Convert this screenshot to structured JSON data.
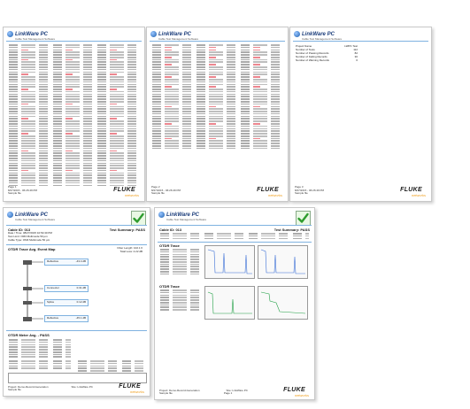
{
  "brand": {
    "product": "LinkWare PC",
    "subtitle": "Cable Test Management Software",
    "fluke": "FLUKE",
    "fluke_sub": "networks"
  },
  "colors": {
    "accent_blue": "#7fb2e0",
    "brand_orange": "#f0a020",
    "fail_red": "#d22233",
    "pass_green": "#2e9c2e"
  },
  "pages": {
    "p1": {
      "page_label": "Page 1",
      "date": "8/27/2015 - 06:26:49 PM",
      "sample": "Sample file"
    },
    "p2": {
      "page_label": "Page 2",
      "date": "8/27/2015 - 06:26:49 PM",
      "sample": "Sample file"
    },
    "p3": {
      "page_label": "Page 3",
      "date": "8/27/2015 - 06:26:49 PM",
      "sample": "Sample file",
      "summary": [
        {
          "label": "Project Name",
          "value": "LWPC Test"
        },
        {
          "label": "Number of Tests",
          "value": "112"
        },
        {
          "label": "Number of Passing Records",
          "value": "82"
        },
        {
          "label": "Number of Failing Records",
          "value": "30"
        },
        {
          "label": "Number of Warning Records",
          "value": "0"
        }
      ]
    },
    "p4": {
      "cable_id": "Cable ID: 013",
      "test_summary": "Test Summary: PASS",
      "date_time": "Date / Time: 08/27/2015 10:54:30 PM",
      "headroom": "Headroom: 2.5 dB (NEXT 45-78)",
      "test_limit": "Test Limit: OM3 Multimode 50 µm",
      "cable_type": "Cable Type: OM3 Multimode 50 µm",
      "otdr_title": "OTDR Trace Avg. Event Map",
      "fiber_length": "Fiber Length: 102.1 ft",
      "total_loss": "Total Loss: 2.22 dB",
      "events": [
        {
          "name": "Reflective",
          "value": "-43.4 dB"
        },
        {
          "name": "Connector",
          "value": "0.31 dB"
        },
        {
          "name": "Splice",
          "value": "0.12 dB"
        },
        {
          "name": "Reflective",
          "value": "-45.1 dB"
        }
      ],
      "pass_section": "OTDR Meter Avg. - PASS",
      "project": "Project: Demo-Record-Generation",
      "site": "Site: LinkWare PC",
      "sample": "Sample file"
    },
    "p5": {
      "cable_id": "Cable ID: 013",
      "test_summary": "Test Summary: PASS",
      "section1": "OTDR Trace",
      "section2": "OTDR Trace",
      "project": "Project: Demo-Record-Generation",
      "site": "Site: LinkWare PC",
      "sample": "Sample file",
      "page_label": "Page 1"
    }
  }
}
